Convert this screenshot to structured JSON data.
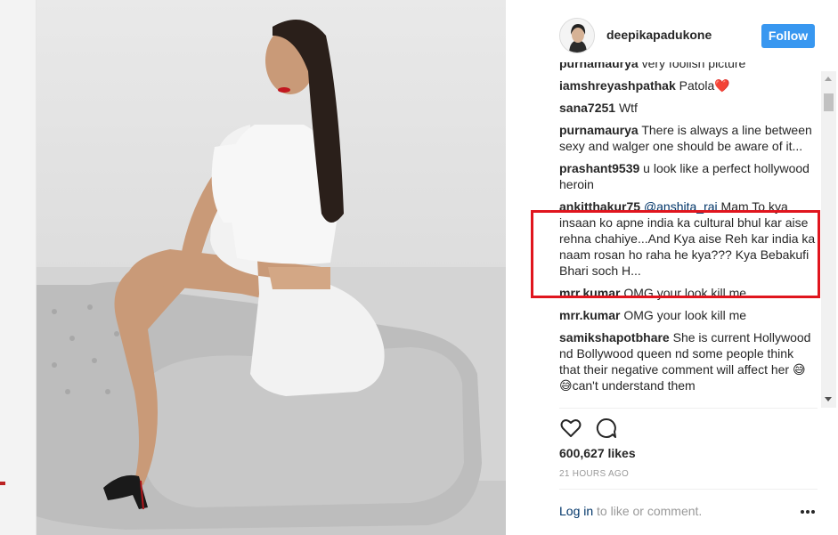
{
  "post": {
    "username": "deepikapadukone",
    "follow_label": "Follow",
    "likes": "600,627 likes",
    "timestamp": "21 HOURS AGO",
    "login_link": "Log in",
    "login_suffix": " to like or comment.",
    "more_label": "•••"
  },
  "comments": [
    {
      "user": "purnamaurya",
      "text": "very foolish picture"
    },
    {
      "user": "iamshreyashpathak",
      "text": "Patola❤️"
    },
    {
      "user": "sana7251",
      "text": "Wtf"
    },
    {
      "user": "purnamaurya",
      "text": "There is always a line between sexy and walger one should be aware of it..."
    },
    {
      "user": "prashant9539",
      "text": "u look like a perfect hollywood heroin"
    },
    {
      "user": "ankitthakur75",
      "mention": "@anshita_rai",
      "text": "Mam To kya insaan ko apne india ka cultural bhul kar aise rehna chahiye...And Kya aise Reh kar india ka naam rosan ho raha he kya??? Kya Bebakufi Bhari soch H..."
    },
    {
      "user": "mrr.kumar",
      "text": "OMG your look kill me"
    },
    {
      "user": "mrr.kumar",
      "text": "OMG your look kill me"
    },
    {
      "user": "samikshapotbhare",
      "text": "She is current Hollywood nd Bollywood queen nd some people think that their negative comment will affect her 😅😅can't understand them"
    }
  ],
  "icons": {
    "like": "heart-icon",
    "comment": "comment-bubble-icon",
    "more": "more-options-icon"
  },
  "colors": {
    "follow_button": "#3897f0",
    "highlight": "#e0151e",
    "link": "#003569"
  }
}
